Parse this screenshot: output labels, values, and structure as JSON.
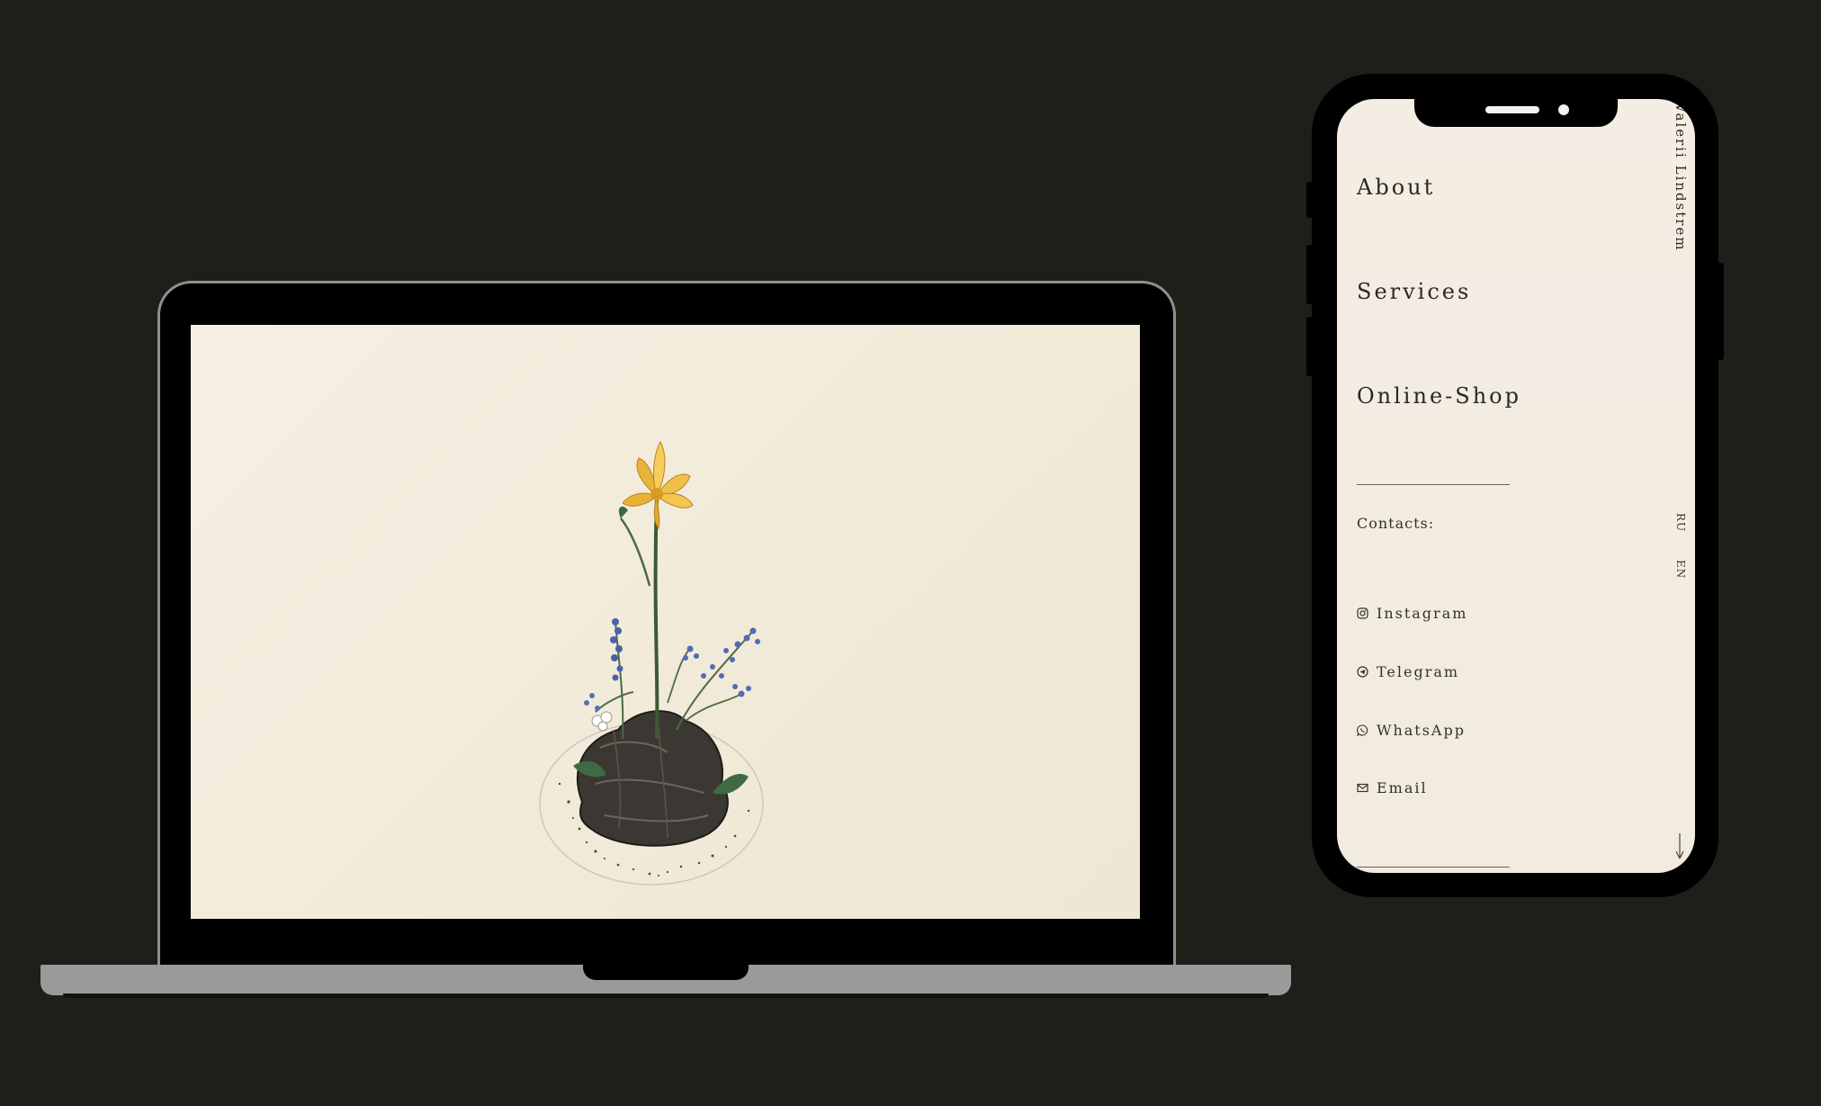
{
  "site": {
    "owner_name": "Valerii Lindstrem",
    "languages": [
      "RU",
      "EN"
    ]
  },
  "phone_menu": {
    "items": [
      {
        "label": "About"
      },
      {
        "label": "Services"
      },
      {
        "label": "Online-Shop"
      }
    ],
    "contacts_label": "Contacts:",
    "contacts": [
      {
        "label": "Instagram",
        "icon": "instagram-icon"
      },
      {
        "label": "Telegram",
        "icon": "telegram-icon"
      },
      {
        "label": "WhatsApp",
        "icon": "whatsapp-icon"
      },
      {
        "label": "Email",
        "icon": "email-icon"
      }
    ]
  },
  "colors": {
    "background": "#1f1e19",
    "screen": "#f4ede2",
    "text": "#2b2923",
    "laptop_frame": "#9a9a9a"
  }
}
